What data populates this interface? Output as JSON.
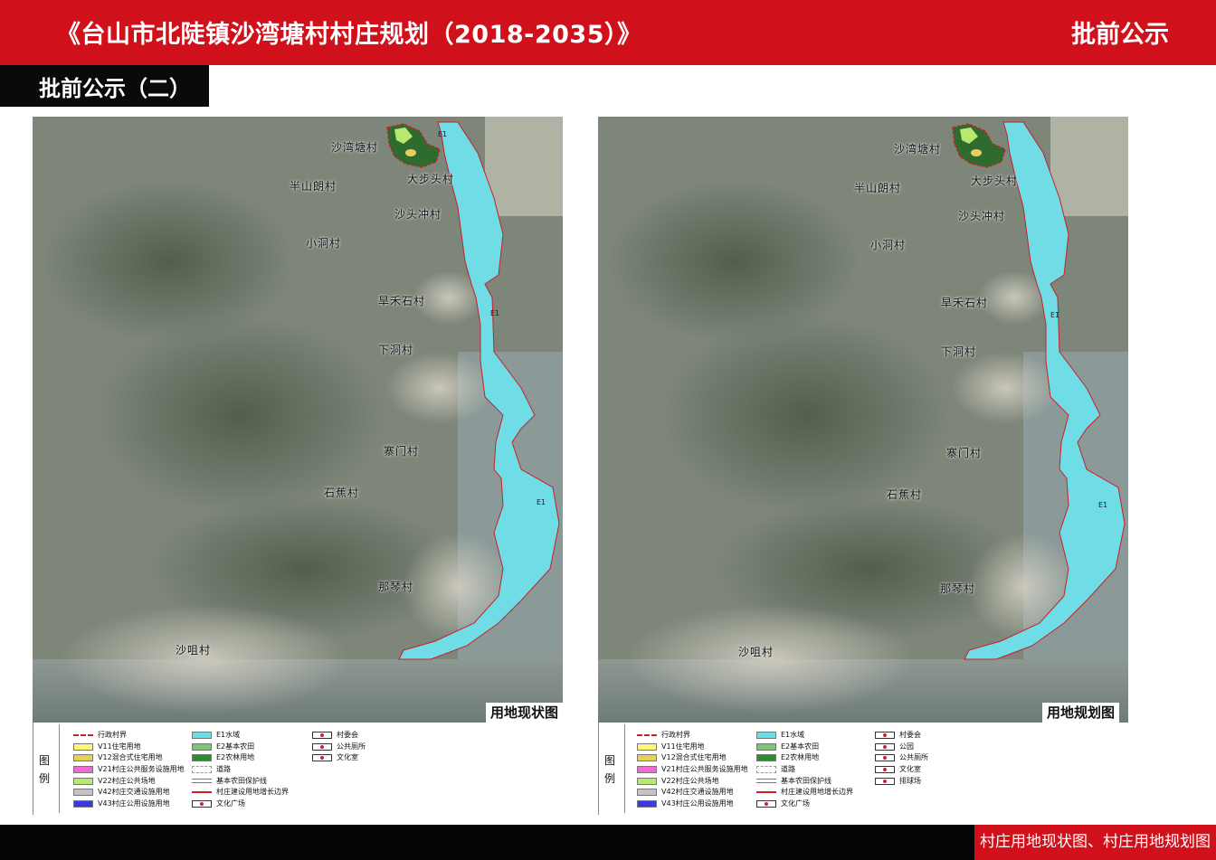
{
  "header": {
    "title": "《台山市北陡镇沙湾塘村村庄规划（2018-2035）》",
    "notice": "批前公示",
    "section": "批前公示（二）"
  },
  "colors": {
    "header_red": "#d0111b",
    "water_cyan": "#6fdce6",
    "boundary_red": "#c8202a",
    "satellite_base": "#7d8679"
  },
  "maps": {
    "left": {
      "title": "用地现状图",
      "villages": [
        "沙湾塘村",
        "大步头村",
        "半山朗村",
        "沙头冲村",
        "小洞村",
        "旱禾石村",
        "下洞村",
        "寨门村",
        "石蕉村",
        "那琴村",
        "沙咀村"
      ],
      "water_labels": [
        "E1",
        "E1",
        "E1"
      ]
    },
    "right": {
      "title": "用地规划图",
      "villages": [
        "沙湾塘村",
        "大步头村",
        "半山朗村",
        "沙头冲村",
        "小洞村",
        "旱禾石村",
        "下洞村",
        "寨门村",
        "石蕉村",
        "那琴村",
        "沙咀村"
      ],
      "water_labels": [
        "E1",
        "E1"
      ]
    }
  },
  "legend": {
    "title": "图例",
    "left": {
      "col1": [
        {
          "label": "行政村界",
          "swatch": "dash",
          "color": "#c8202a"
        },
        {
          "label": "V11住宅用地",
          "swatch": "fill",
          "color": "#fff77a"
        },
        {
          "label": "V12混合式住宅用地",
          "swatch": "fill",
          "color": "#e6cf5a"
        },
        {
          "label": "V21村庄公共服务设施用地",
          "swatch": "fill",
          "color": "#f06ad6"
        },
        {
          "label": "V22村庄公共场地",
          "swatch": "fill",
          "color": "#b8e86e"
        },
        {
          "label": "V42村庄交通设施用地",
          "swatch": "fill",
          "color": "#c4c4c4"
        },
        {
          "label": "V43村庄公用设施用地",
          "swatch": "fill",
          "color": "#3a3ae0"
        }
      ],
      "col2": [
        {
          "label": "E1水域",
          "swatch": "fill",
          "color": "#6fdce6"
        },
        {
          "label": "E2基本农田",
          "swatch": "fill",
          "color": "#7cc47c"
        },
        {
          "label": "E2农林用地",
          "swatch": "fill",
          "color": "#2e8b2e"
        },
        {
          "label": "道路",
          "swatch": "road",
          "color": "#ffffff"
        },
        {
          "label": "基本农田保护线",
          "swatch": "line-green",
          "color": "#3aa03a"
        },
        {
          "label": "村庄建设用地增长边界",
          "swatch": "line-red",
          "color": "#d02020"
        },
        {
          "label": "文化广场",
          "swatch": "sym",
          "color": "#d02030"
        }
      ],
      "col3": [
        {
          "label": "村委会",
          "swatch": "sym",
          "color": "#d02030"
        },
        {
          "label": "公共厕所",
          "swatch": "sym",
          "color": "#d02030"
        },
        {
          "label": "文化室",
          "swatch": "sym",
          "color": "#d02030"
        }
      ]
    },
    "right": {
      "col1": [
        {
          "label": "行政村界",
          "swatch": "dash",
          "color": "#c8202a"
        },
        {
          "label": "V11住宅用地",
          "swatch": "fill",
          "color": "#fff77a"
        },
        {
          "label": "V12混合式住宅用地",
          "swatch": "fill",
          "color": "#e6cf5a"
        },
        {
          "label": "V21村庄公共服务设施用地",
          "swatch": "fill",
          "color": "#f06ad6"
        },
        {
          "label": "V22村庄公共场地",
          "swatch": "fill",
          "color": "#b8e86e"
        },
        {
          "label": "V42村庄交通设施用地",
          "swatch": "fill",
          "color": "#c4c4c4"
        },
        {
          "label": "V43村庄公用设施用地",
          "swatch": "fill",
          "color": "#3a3ae0"
        }
      ],
      "col2": [
        {
          "label": "E1水域",
          "swatch": "fill",
          "color": "#6fdce6"
        },
        {
          "label": "E2基本农田",
          "swatch": "fill",
          "color": "#7cc47c"
        },
        {
          "label": "E2农林用地",
          "swatch": "fill",
          "color": "#2e8b2e"
        },
        {
          "label": "道路",
          "swatch": "road",
          "color": "#ffffff"
        },
        {
          "label": "基本农田保护线",
          "swatch": "line-green",
          "color": "#3aa03a"
        },
        {
          "label": "村庄建设用地增长边界",
          "swatch": "line-red",
          "color": "#d02020"
        },
        {
          "label": "文化广场",
          "swatch": "sym",
          "color": "#d02030"
        }
      ],
      "col3": [
        {
          "label": "村委会",
          "swatch": "sym",
          "color": "#d02030"
        },
        {
          "label": "公园",
          "swatch": "sym",
          "color": "#d02030"
        },
        {
          "label": "公共厕所",
          "swatch": "sym",
          "color": "#d02030"
        },
        {
          "label": "文化室",
          "swatch": "sym",
          "color": "#d02030"
        },
        {
          "label": "排球场",
          "swatch": "sym",
          "color": "#d02030"
        }
      ]
    }
  },
  "footer": {
    "caption": "村庄用地现状图、村庄用地规划图"
  }
}
